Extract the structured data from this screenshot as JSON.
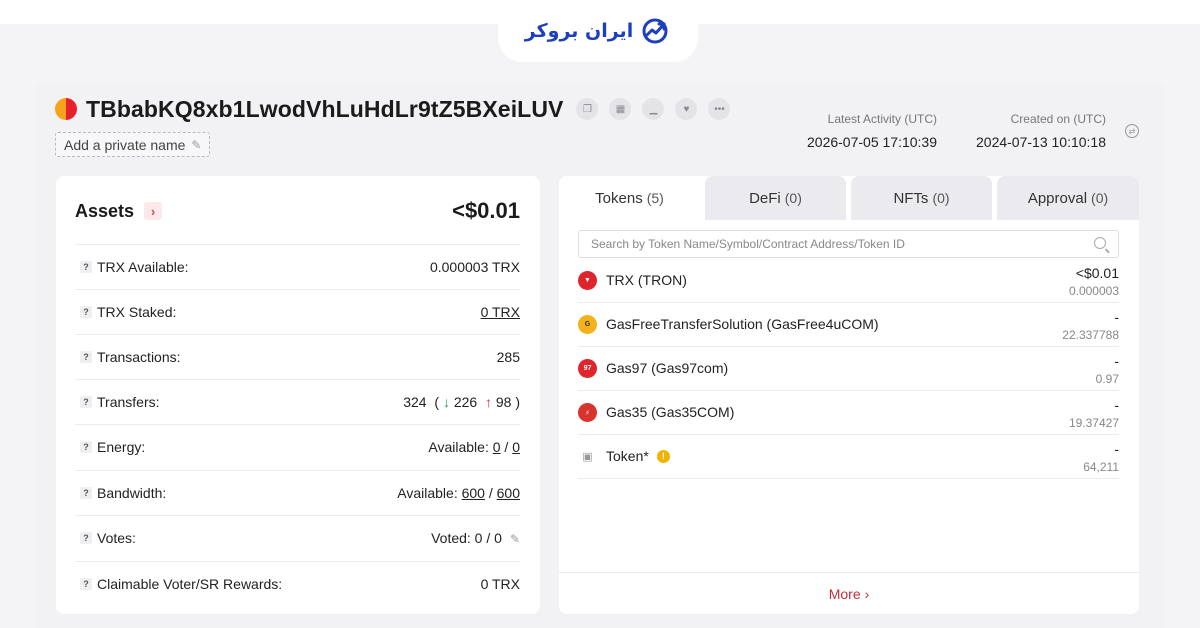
{
  "logo": {
    "text": "ایران بروکر",
    "icon": "chart-growth-icon"
  },
  "account": {
    "address": "TBbabKQ8xb1LwodVhLuHdLr9tZ5BXeiLUV",
    "private_name_label": "Add a private name",
    "latest_activity_label": "Latest Activity (UTC)",
    "latest_activity": "2026-07-05 17:10:39",
    "created_on_label": "Created on (UTC)",
    "created_on": "2024-07-13 10:10:18"
  },
  "assets": {
    "title": "Assets",
    "total": "<$0.01",
    "rows": [
      {
        "label": "TRX Available:",
        "value": "0.000003 TRX"
      },
      {
        "label": "TRX Staked:",
        "value": "0 TRX"
      },
      {
        "label": "Transactions:",
        "value": "285"
      },
      {
        "label": "Transfers:",
        "total": "324",
        "in": "226",
        "out": "98"
      },
      {
        "label": "Energy:",
        "prefix": "Available:",
        "used": "0",
        "total": "0"
      },
      {
        "label": "Bandwidth:",
        "prefix": "Available:",
        "used": "600",
        "total": "600"
      },
      {
        "label": "Votes:",
        "value": "Voted: 0 / 0"
      },
      {
        "label": "Claimable Voter/SR Rewards:",
        "value": "0 TRX"
      }
    ]
  },
  "tabs": [
    {
      "label": "Tokens",
      "count": "(5)"
    },
    {
      "label": "DeFi",
      "count": "(0)"
    },
    {
      "label": "NFTs",
      "count": "(0)"
    },
    {
      "label": "Approval",
      "count": "(0)"
    }
  ],
  "search": {
    "placeholder": "Search by Token Name/Symbol/Contract Address/Token ID"
  },
  "tokens": [
    {
      "name": "TRX (TRON)",
      "value": "<$0.01",
      "amount": "0.000003",
      "color": "#e0242d"
    },
    {
      "name": "GasFreeTransferSolution (GasFree4uCOM)",
      "value": "-",
      "amount": "22.337788",
      "color": "#f4b21a"
    },
    {
      "name": "Gas97 (Gas97com)",
      "value": "-",
      "amount": "0.97",
      "color": "#e0242d"
    },
    {
      "name": "Gas35 (Gas35COM)",
      "value": "-",
      "amount": "19.37427",
      "color": "#d9342b"
    },
    {
      "name": "Token*",
      "value": "-",
      "amount": "64,211",
      "color": "#cfcfd4"
    }
  ],
  "more_label": "More"
}
